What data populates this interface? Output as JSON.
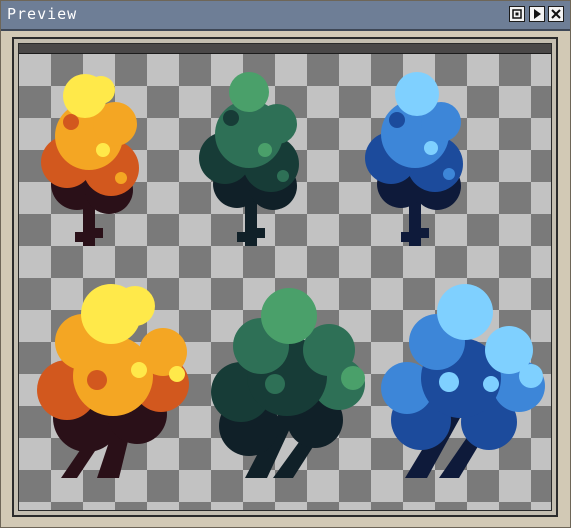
{
  "window": {
    "title": "Preview",
    "buttons": [
      {
        "name": "zoom-fit-button",
        "icon": "zoom-fit-icon"
      },
      {
        "name": "play-button",
        "icon": "play-icon"
      },
      {
        "name": "close-button",
        "icon": "close-icon"
      }
    ]
  },
  "canvas": {
    "background": "transparency-checkerboard",
    "checker_colors": [
      "#7a7a7a",
      "#c2c2c2"
    ]
  },
  "sprites": [
    {
      "name": "tree-small-autumn",
      "palette": [
        "#ffe94a",
        "#f4a623",
        "#d2581e",
        "#2a1018"
      ]
    },
    {
      "name": "tree-small-green",
      "palette": [
        "#4aa06a",
        "#2e7056",
        "#173c37",
        "#102028"
      ]
    },
    {
      "name": "tree-small-blue",
      "palette": [
        "#7fd0ff",
        "#3d86d8",
        "#1c4b9c",
        "#0e1a3a"
      ]
    },
    {
      "name": "tree-large-autumn",
      "palette": [
        "#ffe94a",
        "#f4a623",
        "#d2581e",
        "#2a1018"
      ]
    },
    {
      "name": "tree-large-green",
      "palette": [
        "#4aa06a",
        "#2e7056",
        "#173c37",
        "#102028"
      ]
    },
    {
      "name": "tree-large-blue",
      "palette": [
        "#7fd0ff",
        "#3d86d8",
        "#1c4b9c",
        "#0e1a3a"
      ]
    }
  ]
}
